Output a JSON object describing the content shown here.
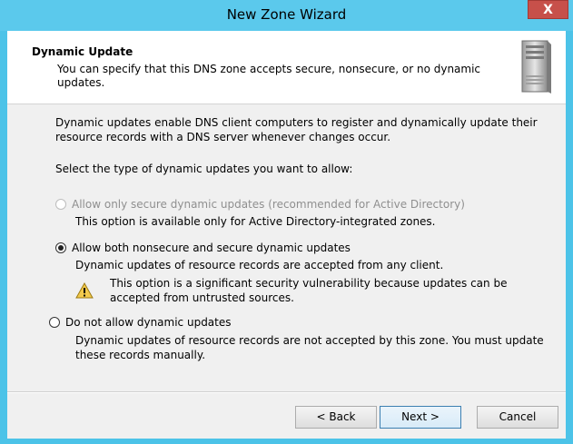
{
  "window": {
    "title": "New Zone Wizard",
    "close_label": "X"
  },
  "header": {
    "title": "Dynamic Update",
    "description": "You can specify that this DNS zone accepts secure, nonsecure, or no dynamic updates."
  },
  "content": {
    "intro": "Dynamic updates enable DNS client computers to register and dynamically update their resource records with a DNS server whenever changes occur.",
    "prompt": "Select the type of dynamic updates you want to allow:",
    "options": [
      {
        "label": "Allow only secure dynamic updates (recommended for Active Directory)",
        "description": "This option is available only for Active Directory-integrated zones.",
        "selected": false,
        "enabled": false
      },
      {
        "label": "Allow both nonsecure and secure dynamic updates",
        "description": "Dynamic updates of resource records are accepted from any client.",
        "warning": "This option is a significant security vulnerability because updates can be accepted from untrusted sources.",
        "selected": true,
        "enabled": true
      },
      {
        "label": "Do not allow dynamic updates",
        "description": "Dynamic updates of resource records are not accepted by this zone. You must update these records manually.",
        "selected": false,
        "enabled": true
      }
    ]
  },
  "buttons": {
    "back": "< Back",
    "next": "Next >",
    "cancel": "Cancel"
  },
  "colors": {
    "titlebar": "#5bc9ec",
    "close": "#c7504a",
    "dialog_bg": "#f0f0f0",
    "warning": "#f2c94c"
  },
  "icons": {
    "header": "dns-server-icon",
    "warning": "warning-icon",
    "close": "close-icon"
  }
}
